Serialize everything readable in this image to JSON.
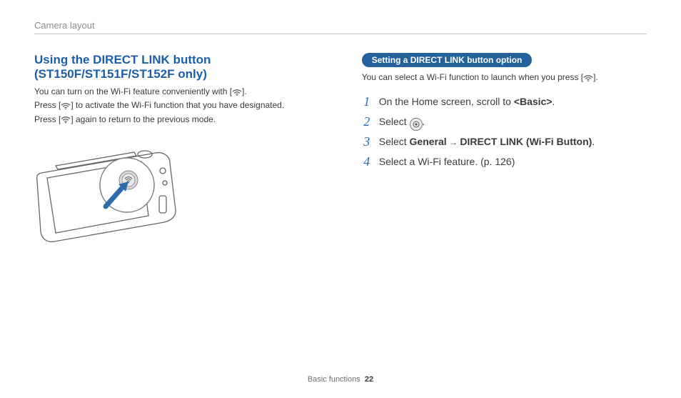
{
  "section_header": "Camera layout",
  "left": {
    "heading": "Using the DIRECT LINK button (ST150F/ST151F/ST152F only)",
    "p1a": "You can turn on the Wi-Fi feature conveniently with [",
    "p1b": "].",
    "p2a": "Press [",
    "p2b": "] to activate the Wi-Fi function that you have designated.",
    "p3a": "Press [",
    "p3b": "] again to return to the previous mode."
  },
  "right": {
    "pill": "Setting a DIRECT LINK button option",
    "intro_a": "You can select a Wi-Fi function to launch when you press [",
    "intro_b": "].",
    "steps": {
      "s1_a": "On the Home screen, scroll to ",
      "s1_b": "<Basic>",
      "s1_c": ".",
      "s2_a": "Select ",
      "s2_b": ".",
      "s3_a": "Select ",
      "s3_b": "General",
      "s3_arrow": " → ",
      "s3_c": "DIRECT LINK (Wi-Fi Button)",
      "s3_d": ".",
      "s4": "Select a Wi-Fi feature. (p. 126)"
    }
  },
  "footer": {
    "label": "Basic functions",
    "page": "22"
  }
}
